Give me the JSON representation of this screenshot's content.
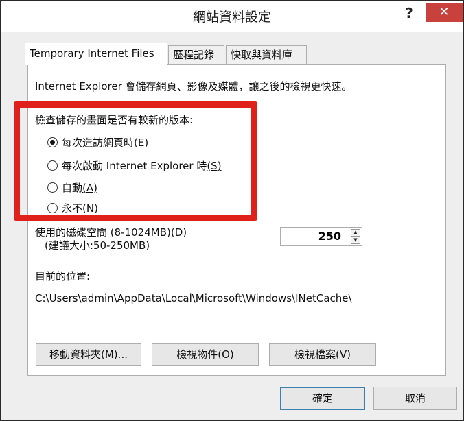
{
  "window": {
    "title": "網站資料設定",
    "help": "?",
    "close": "✕"
  },
  "tabs": [
    {
      "label": "Temporary Internet Files",
      "active": true
    },
    {
      "label": "歷程記錄",
      "active": false
    },
    {
      "label": "快取與資料庫",
      "active": false
    }
  ],
  "panel": {
    "description": "Internet Explorer 會儲存網頁、影像及媒體，讓之後的檢視更快速。",
    "check_label": "檢查儲存的畫面是否有較新的版本:",
    "options": [
      {
        "label": "每次造訪網頁時",
        "key": "(E)",
        "checked": true
      },
      {
        "label": "每次啟動 Internet Explorer 時",
        "key": "(S)",
        "checked": false
      },
      {
        "label": "自動",
        "key": "(A)",
        "checked": false
      },
      {
        "label": "永不",
        "key": "(N)",
        "checked": false
      }
    ],
    "disk_label": "使用的磁碟空間 (8-1024MB)",
    "disk_key": "(D)",
    "disk_hint": "(建議大小:50-250MB)",
    "disk_value": "250",
    "location_label": "目前的位置:",
    "location_path": "C:\\Users\\admin\\AppData\\Local\\Microsoft\\Windows\\INetCache\\",
    "buttons": {
      "move_label": "移動資料夾",
      "move_key": "(M)",
      "move_suffix": "...",
      "view_objects_label": "檢視物件",
      "view_objects_key": "(O)",
      "view_files_label": "檢視檔案",
      "view_files_key": "(V)"
    }
  },
  "footer": {
    "ok": "確定",
    "cancel": "取消"
  },
  "colors": {
    "highlight_border": "#e0201b",
    "close_button": "#c9413d",
    "primary_border": "#3c7fb1"
  }
}
